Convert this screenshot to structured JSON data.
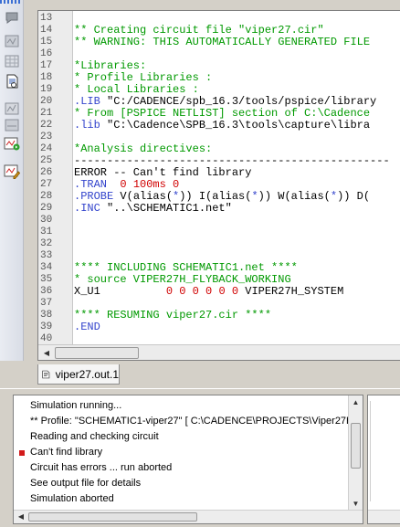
{
  "toolbar": {
    "tools": [
      {
        "icon": "chat-bubble-icon"
      },
      {
        "icon": "waveform-panel-icon"
      },
      {
        "icon": "grid-panel-icon"
      },
      {
        "icon": "output-file-icon"
      },
      {
        "icon": "plot-window-icon"
      },
      {
        "icon": "waveform-panel-icon"
      },
      {
        "icon": "run-simulation-icon"
      },
      {
        "icon": "edit-profile-icon"
      }
    ]
  },
  "editor": {
    "lines": [
      {
        "num": "13",
        "text": "",
        "color": "black"
      },
      {
        "num": "14",
        "text": "** Creating circuit file \"viper27.cir\"",
        "color": "green"
      },
      {
        "num": "15",
        "text": "** WARNING: THIS AUTOMATICALLY GENERATED FILE",
        "color": "green"
      },
      {
        "num": "16",
        "text": "",
        "color": "black"
      },
      {
        "num": "17",
        "text": "*Libraries:",
        "color": "green"
      },
      {
        "num": "18",
        "text": "* Profile Libraries :",
        "color": "green"
      },
      {
        "num": "19",
        "text": "* Local Libraries :",
        "color": "green"
      },
      {
        "num": "20",
        "text": ".LIB \"C:/CADENCE/spb_16.3/tools/pspice/library",
        "color": "mixed-lib1"
      },
      {
        "num": "21",
        "text": "* From [PSPICE NETLIST] section of C:\\Cadence",
        "color": "green"
      },
      {
        "num": "22",
        "text": ".lib \"C:\\Cadence\\SPB_16.3\\tools\\capture\\libra",
        "color": "mixed-lib2"
      },
      {
        "num": "23",
        "text": "",
        "color": "black"
      },
      {
        "num": "24",
        "text": "*Analysis directives:",
        "color": "green"
      },
      {
        "num": "25",
        "text": "------------------------------------------------",
        "color": "black"
      },
      {
        "num": "26",
        "text": "ERROR -- Can't find library",
        "color": "black"
      },
      {
        "num": "27",
        "text": ".TRAN  0 100ms 0",
        "color": "mixed-tran"
      },
      {
        "num": "28",
        "text": ".PROBE V(alias(*)) I(alias(*)) W(alias(*)) D(",
        "color": "mixed-probe"
      },
      {
        "num": "29",
        "text": ".INC \"..\\SCHEMATIC1.net\"",
        "color": "mixed-inc"
      },
      {
        "num": "30",
        "text": "",
        "color": "black"
      },
      {
        "num": "31",
        "text": "",
        "color": "black"
      },
      {
        "num": "32",
        "text": "",
        "color": "black"
      },
      {
        "num": "33",
        "text": "",
        "color": "black"
      },
      {
        "num": "34",
        "text": "**** INCLUDING SCHEMATIC1.net ****",
        "color": "green"
      },
      {
        "num": "35",
        "text": "* source VIPER27H_FLYBACK_WORKING",
        "color": "green"
      },
      {
        "num": "36",
        "text": "X_U1          0 0 0 0 0 0 VIPER27H_SYSTEM",
        "color": "mixed-xu1"
      },
      {
        "num": "37",
        "text": "",
        "color": "black"
      },
      {
        "num": "38",
        "text": "**** RESUMING viper27.cir ****",
        "color": "green"
      },
      {
        "num": "39",
        "text": ".END",
        "color": "blue"
      },
      {
        "num": "40",
        "text": "",
        "color": "black"
      }
    ]
  },
  "tabs": {
    "active_label": "viper27.out.1"
  },
  "simulation": {
    "messages": [
      {
        "text": "Simulation running...",
        "error": false
      },
      {
        "text": "** Profile: \"SCHEMATIC1-viper27\"  [ C:\\CADENCE\\PROJECTS\\Viper27H",
        "error": false
      },
      {
        "text": "Reading and checking circuit",
        "error": false
      },
      {
        "text": "Can't find library",
        "error": true
      },
      {
        "text": "Circuit has errors ... run aborted",
        "error": false
      },
      {
        "text": "See output file for details",
        "error": false
      },
      {
        "text": "Simulation aborted",
        "error": false
      }
    ]
  },
  "colors": {
    "comment": "#009900",
    "keyword": "#3344cc",
    "number": "#d00000",
    "error_marker": "#d21a1a"
  }
}
